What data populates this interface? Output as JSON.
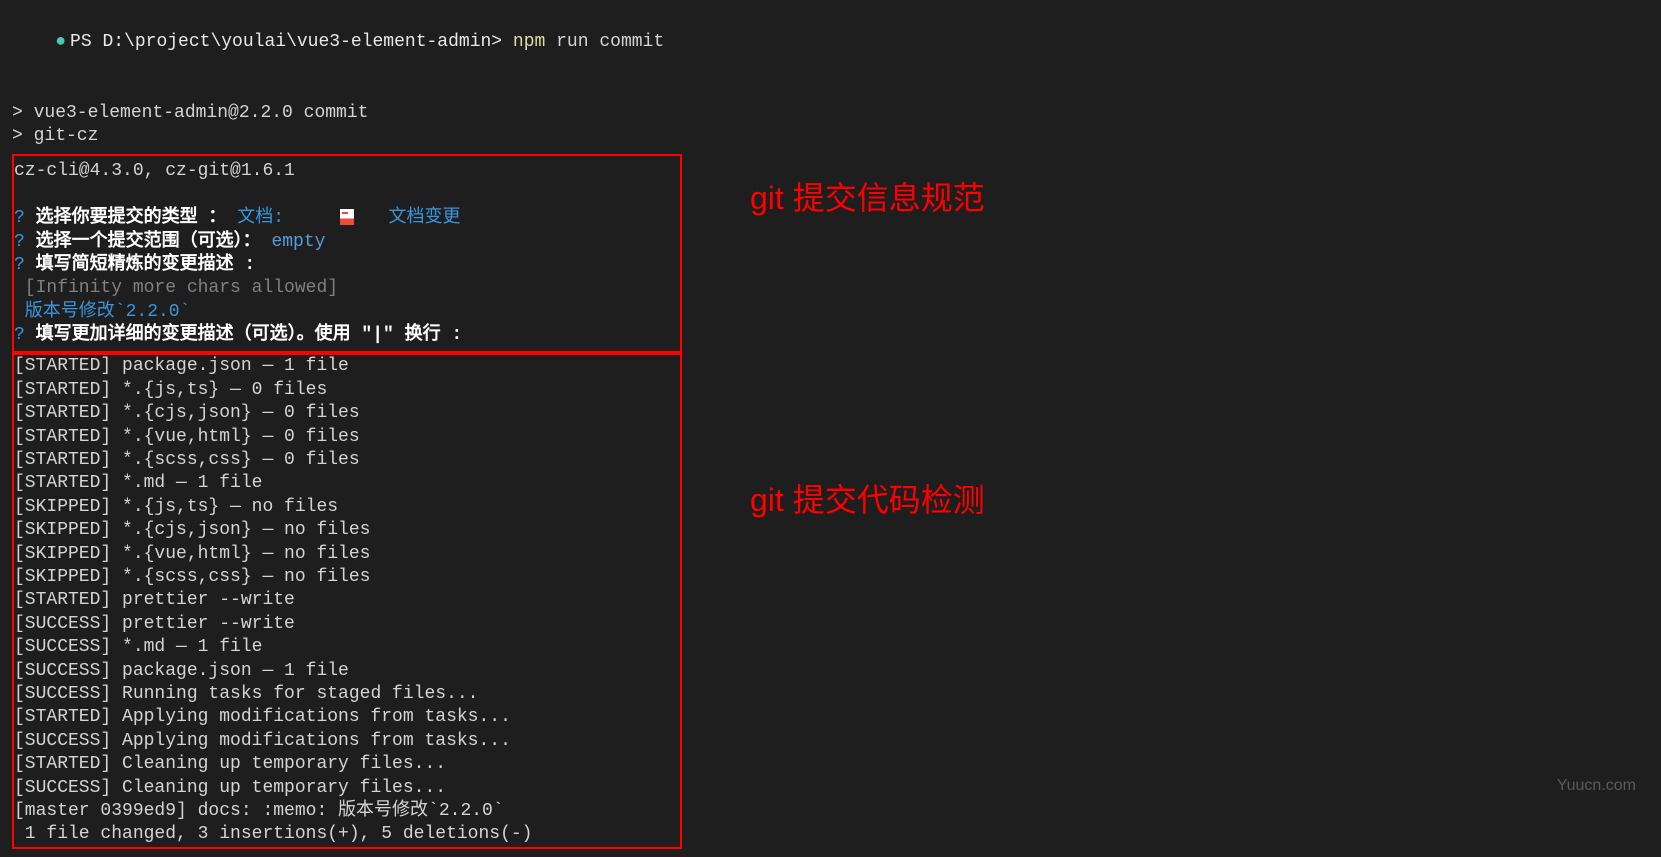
{
  "prompt": {
    "dot": "●",
    "ps": "PS ",
    "path": "D:\\project\\youlai\\vue3-element-admin>",
    "cmd_npm": " npm",
    "cmd_args": " run commit"
  },
  "npm_output": {
    "line1": "> vue3-element-admin@2.2.0 commit",
    "line2": "> git-cz"
  },
  "cz": {
    "header": "cz-cli@4.3.0, cz-git@1.6.1",
    "q1_prompt": "选择你要提交的类型 ：",
    "q1_answer_prefix": "文档:",
    "q1_answer_suffix": "   文档变更",
    "q2_prompt": "选择一个提交范围（可选）：",
    "q2_answer": "empty",
    "q3_prompt": "填写简短精炼的变更描述 :",
    "q3_hint": " [Infinity more chars allowed]",
    "q3_answer": " 版本号修改`2.2.0`",
    "q4_prompt": "填写更加详细的变更描述（可选）。使用 \"|\" 换行 :"
  },
  "lint": {
    "lines": [
      "[STARTED] package.json — 1 file",
      "[STARTED] *.{js,ts} — 0 files",
      "[STARTED] *.{cjs,json} — 0 files",
      "[STARTED] *.{vue,html} — 0 files",
      "[STARTED] *.{scss,css} — 0 files",
      "[STARTED] *.md — 1 file",
      "[SKIPPED] *.{js,ts} — no files",
      "[SKIPPED] *.{cjs,json} — no files",
      "[SKIPPED] *.{vue,html} — no files",
      "[SKIPPED] *.{scss,css} — no files",
      "[STARTED] prettier --write",
      "[SUCCESS] prettier --write",
      "[SUCCESS] *.md — 1 file",
      "[SUCCESS] package.json — 1 file",
      "[SUCCESS] Running tasks for staged files...",
      "[STARTED] Applying modifications from tasks...",
      "[SUCCESS] Applying modifications from tasks...",
      "[STARTED] Cleaning up temporary files...",
      "[SUCCESS] Cleaning up temporary files...",
      "[master 0399ed9] docs: :memo: 版本号修改`2.2.0`",
      " 1 file changed, 3 insertions(+), 5 deletions(-)"
    ]
  },
  "annotations": {
    "top": "git 提交信息规范",
    "bottom": "git 提交代码检测"
  },
  "watermark": "Yuucn.com"
}
